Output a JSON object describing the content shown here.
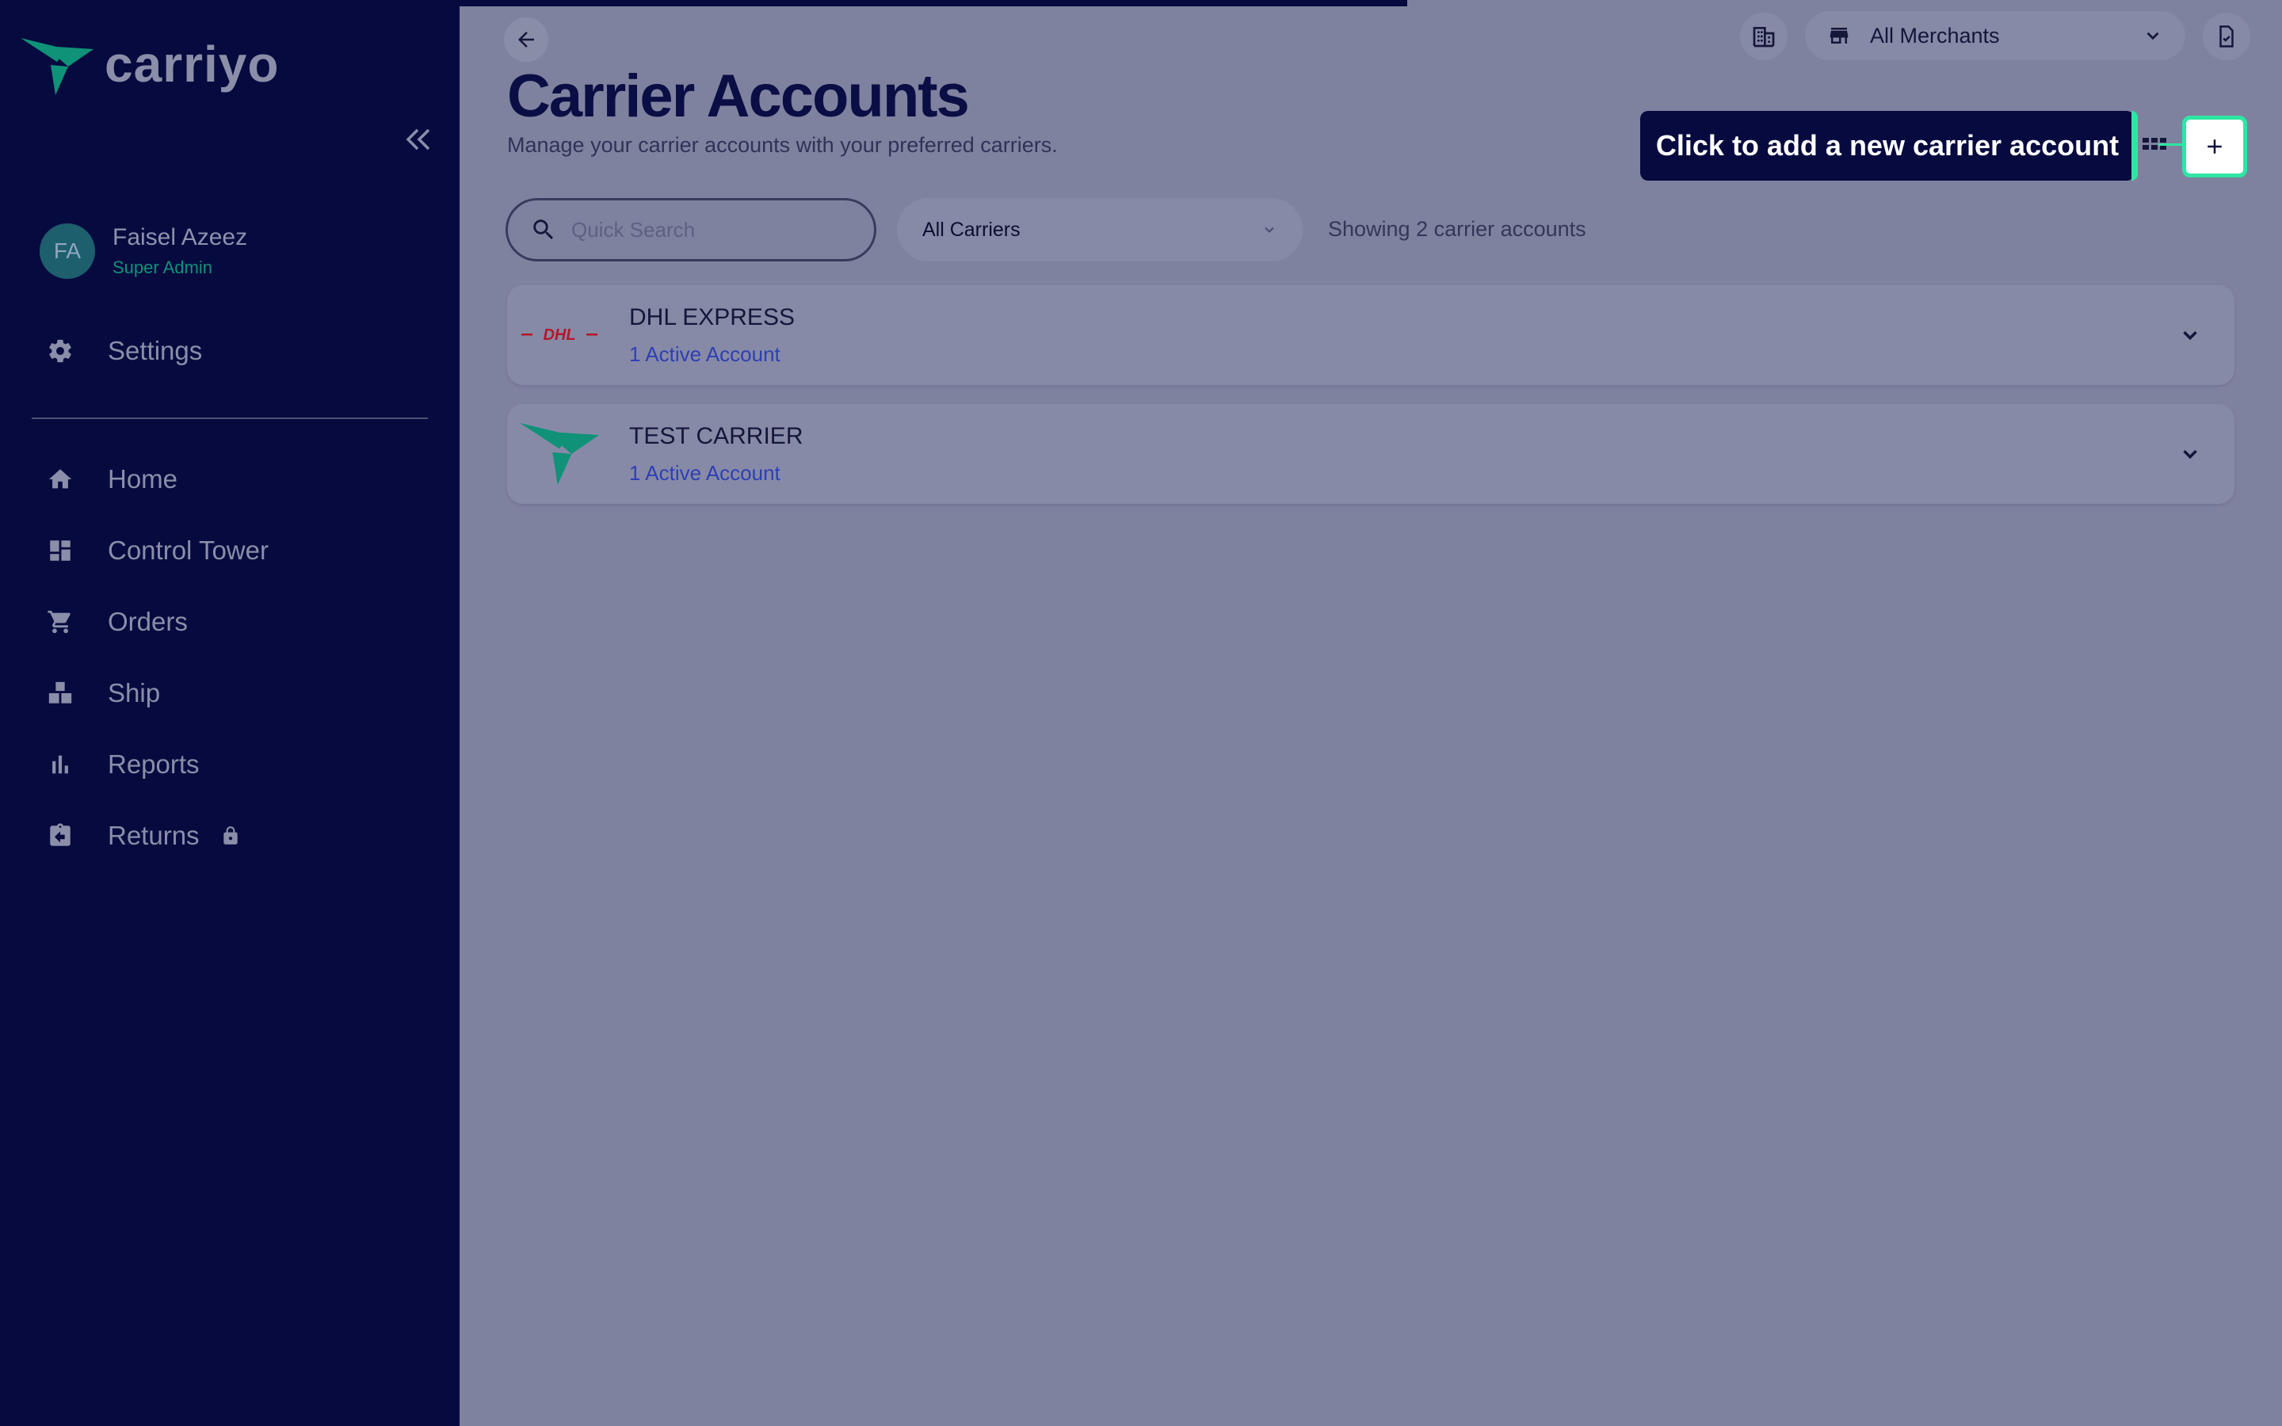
{
  "app": {
    "brand": "carriyo"
  },
  "sidebar": {
    "user": {
      "initials": "FA",
      "name": "Faisel Azeez",
      "role": "Super Admin"
    },
    "settings_label": "Settings",
    "items": [
      {
        "label": "Home",
        "icon": "home-icon"
      },
      {
        "label": "Control Tower",
        "icon": "dashboard-icon"
      },
      {
        "label": "Orders",
        "icon": "cart-icon"
      },
      {
        "label": "Ship",
        "icon": "boxes-icon"
      },
      {
        "label": "Reports",
        "icon": "bar-chart-icon"
      },
      {
        "label": "Returns",
        "icon": "return-box-icon",
        "locked": true
      }
    ]
  },
  "header": {
    "merchant_select": {
      "value": "All Merchants"
    },
    "title": "Carrier Accounts",
    "subtitle": "Manage your carrier accounts with your preferred carriers."
  },
  "tooltip": {
    "text": "Click to add a new carrier account"
  },
  "toolbar": {
    "search_placeholder": "Quick Search",
    "carrier_filter": "All Carriers",
    "showing_text": "Showing 2 carrier accounts"
  },
  "carriers": [
    {
      "name": "DHL EXPRESS",
      "status": "1 Active Account",
      "logo": "dhl-logo"
    },
    {
      "name": "TEST CARRIER",
      "status": "1 Active Account",
      "logo": "carriyo-logo"
    }
  ],
  "colors": {
    "sidebar_bg": "#070a3f",
    "overlay_bg": "#7f829f",
    "accent_green": "#2ee6a3",
    "link_blue": "#2e3fb4",
    "brand_teal": "#0f9278",
    "dhl_red": "#b5162b"
  }
}
